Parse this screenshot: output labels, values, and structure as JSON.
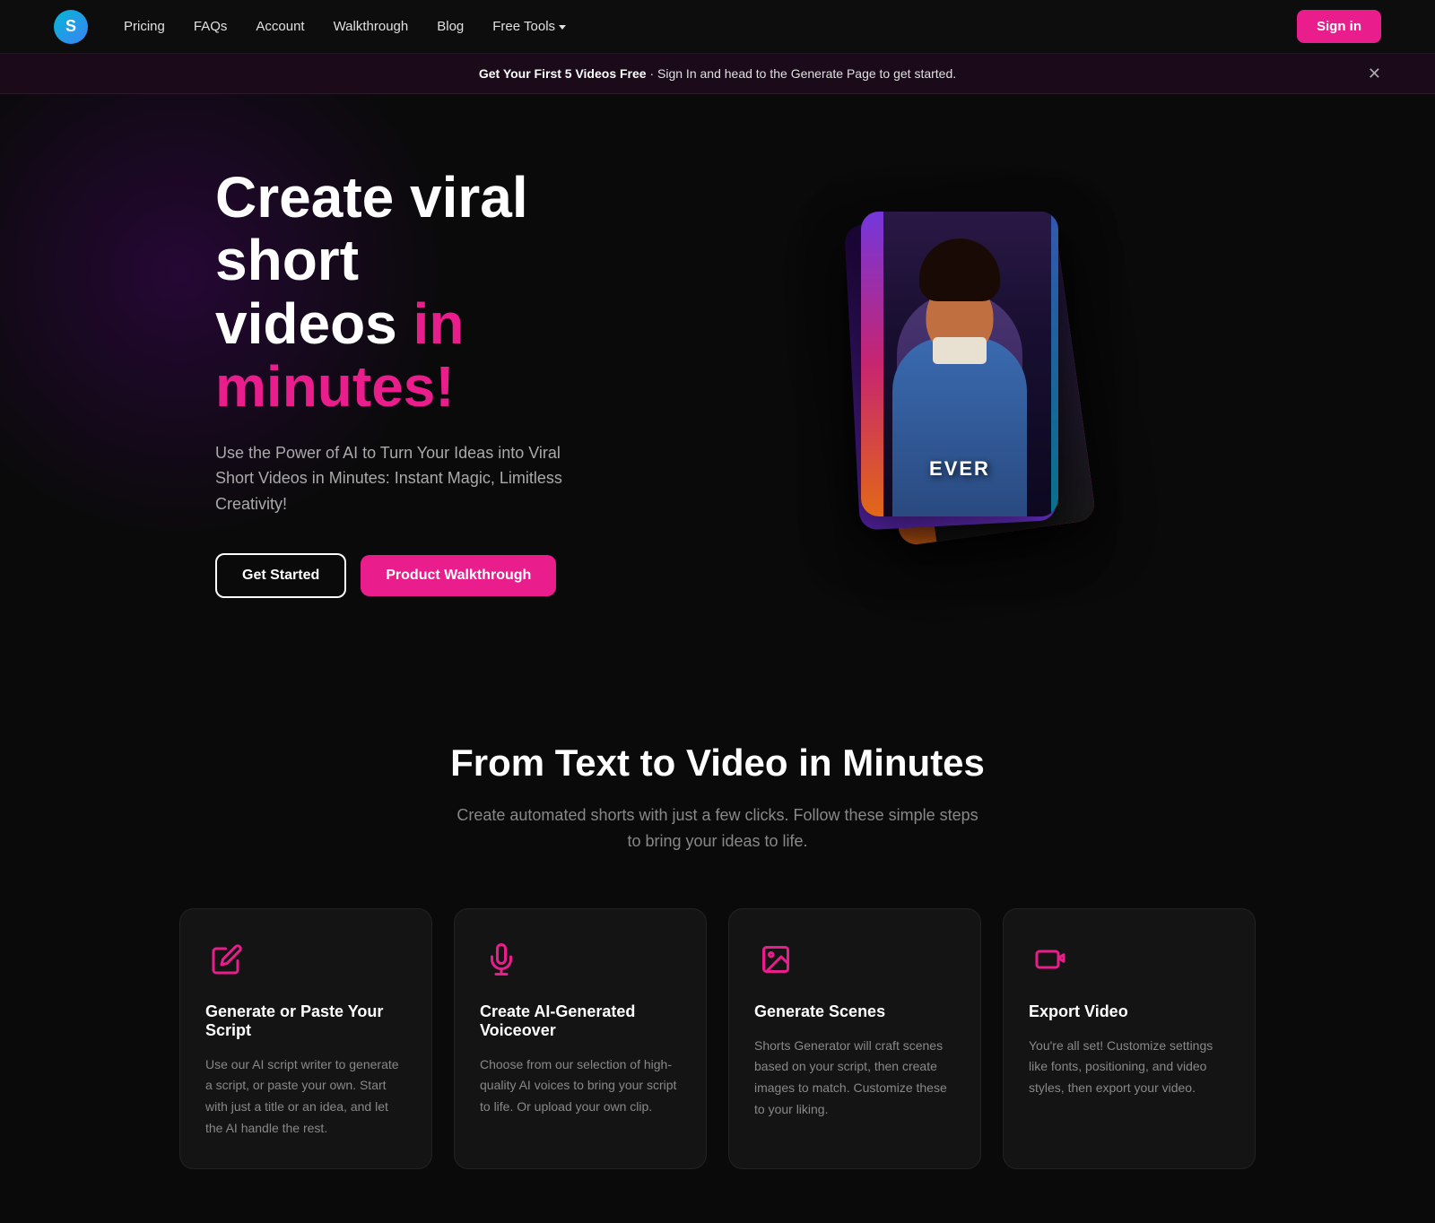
{
  "brand": {
    "logo_text": "S",
    "logo_aria": "Shorts Generator Logo"
  },
  "nav": {
    "links": [
      {
        "label": "Pricing",
        "href": "#"
      },
      {
        "label": "FAQs",
        "href": "#"
      },
      {
        "label": "Account",
        "href": "#"
      },
      {
        "label": "Walkthrough",
        "href": "#"
      },
      {
        "label": "Blog",
        "href": "#"
      },
      {
        "label": "Free Tools",
        "href": "#",
        "has_dropdown": true
      }
    ],
    "sign_in_label": "Sign in"
  },
  "banner": {
    "strong": "Get Your First 5 Videos Free",
    "rest": " · Sign In and head to the Generate Page to get started."
  },
  "hero": {
    "title_line1": "Create viral short",
    "title_line2": "videos ",
    "title_highlight": "in minutes!",
    "subtitle": "Use the Power of AI to Turn Your Ideas into Viral Short Videos in Minutes: Instant Magic, Limitless Creativity!",
    "btn_get_started": "Get Started",
    "btn_walkthrough": "Product Walkthrough",
    "video_overlay_text": "EVER"
  },
  "features": {
    "title": "From Text to Video in Minutes",
    "subtitle": "Create automated shorts with just a few clicks. Follow these simple steps to bring your ideas to life.",
    "cards": [
      {
        "id": "script",
        "icon": "pencil",
        "title": "Generate or Paste Your Script",
        "text": "Use our AI script writer to generate a script, or paste your own. Start with just a title or an idea, and let the AI handle the rest."
      },
      {
        "id": "voiceover",
        "icon": "microphone",
        "title": "Create AI-Generated Voiceover",
        "text": "Choose from our selection of high-quality AI voices to bring your script to life. Or upload your own clip."
      },
      {
        "id": "scenes",
        "icon": "image",
        "title": "Generate Scenes",
        "text": "Shorts Generator will craft scenes based on your script, then create images to match. Customize these to your liking."
      },
      {
        "id": "export",
        "icon": "video",
        "title": "Export Video",
        "text": "You're all set! Customize settings like fonts, positioning, and video styles, then export your video."
      }
    ]
  }
}
